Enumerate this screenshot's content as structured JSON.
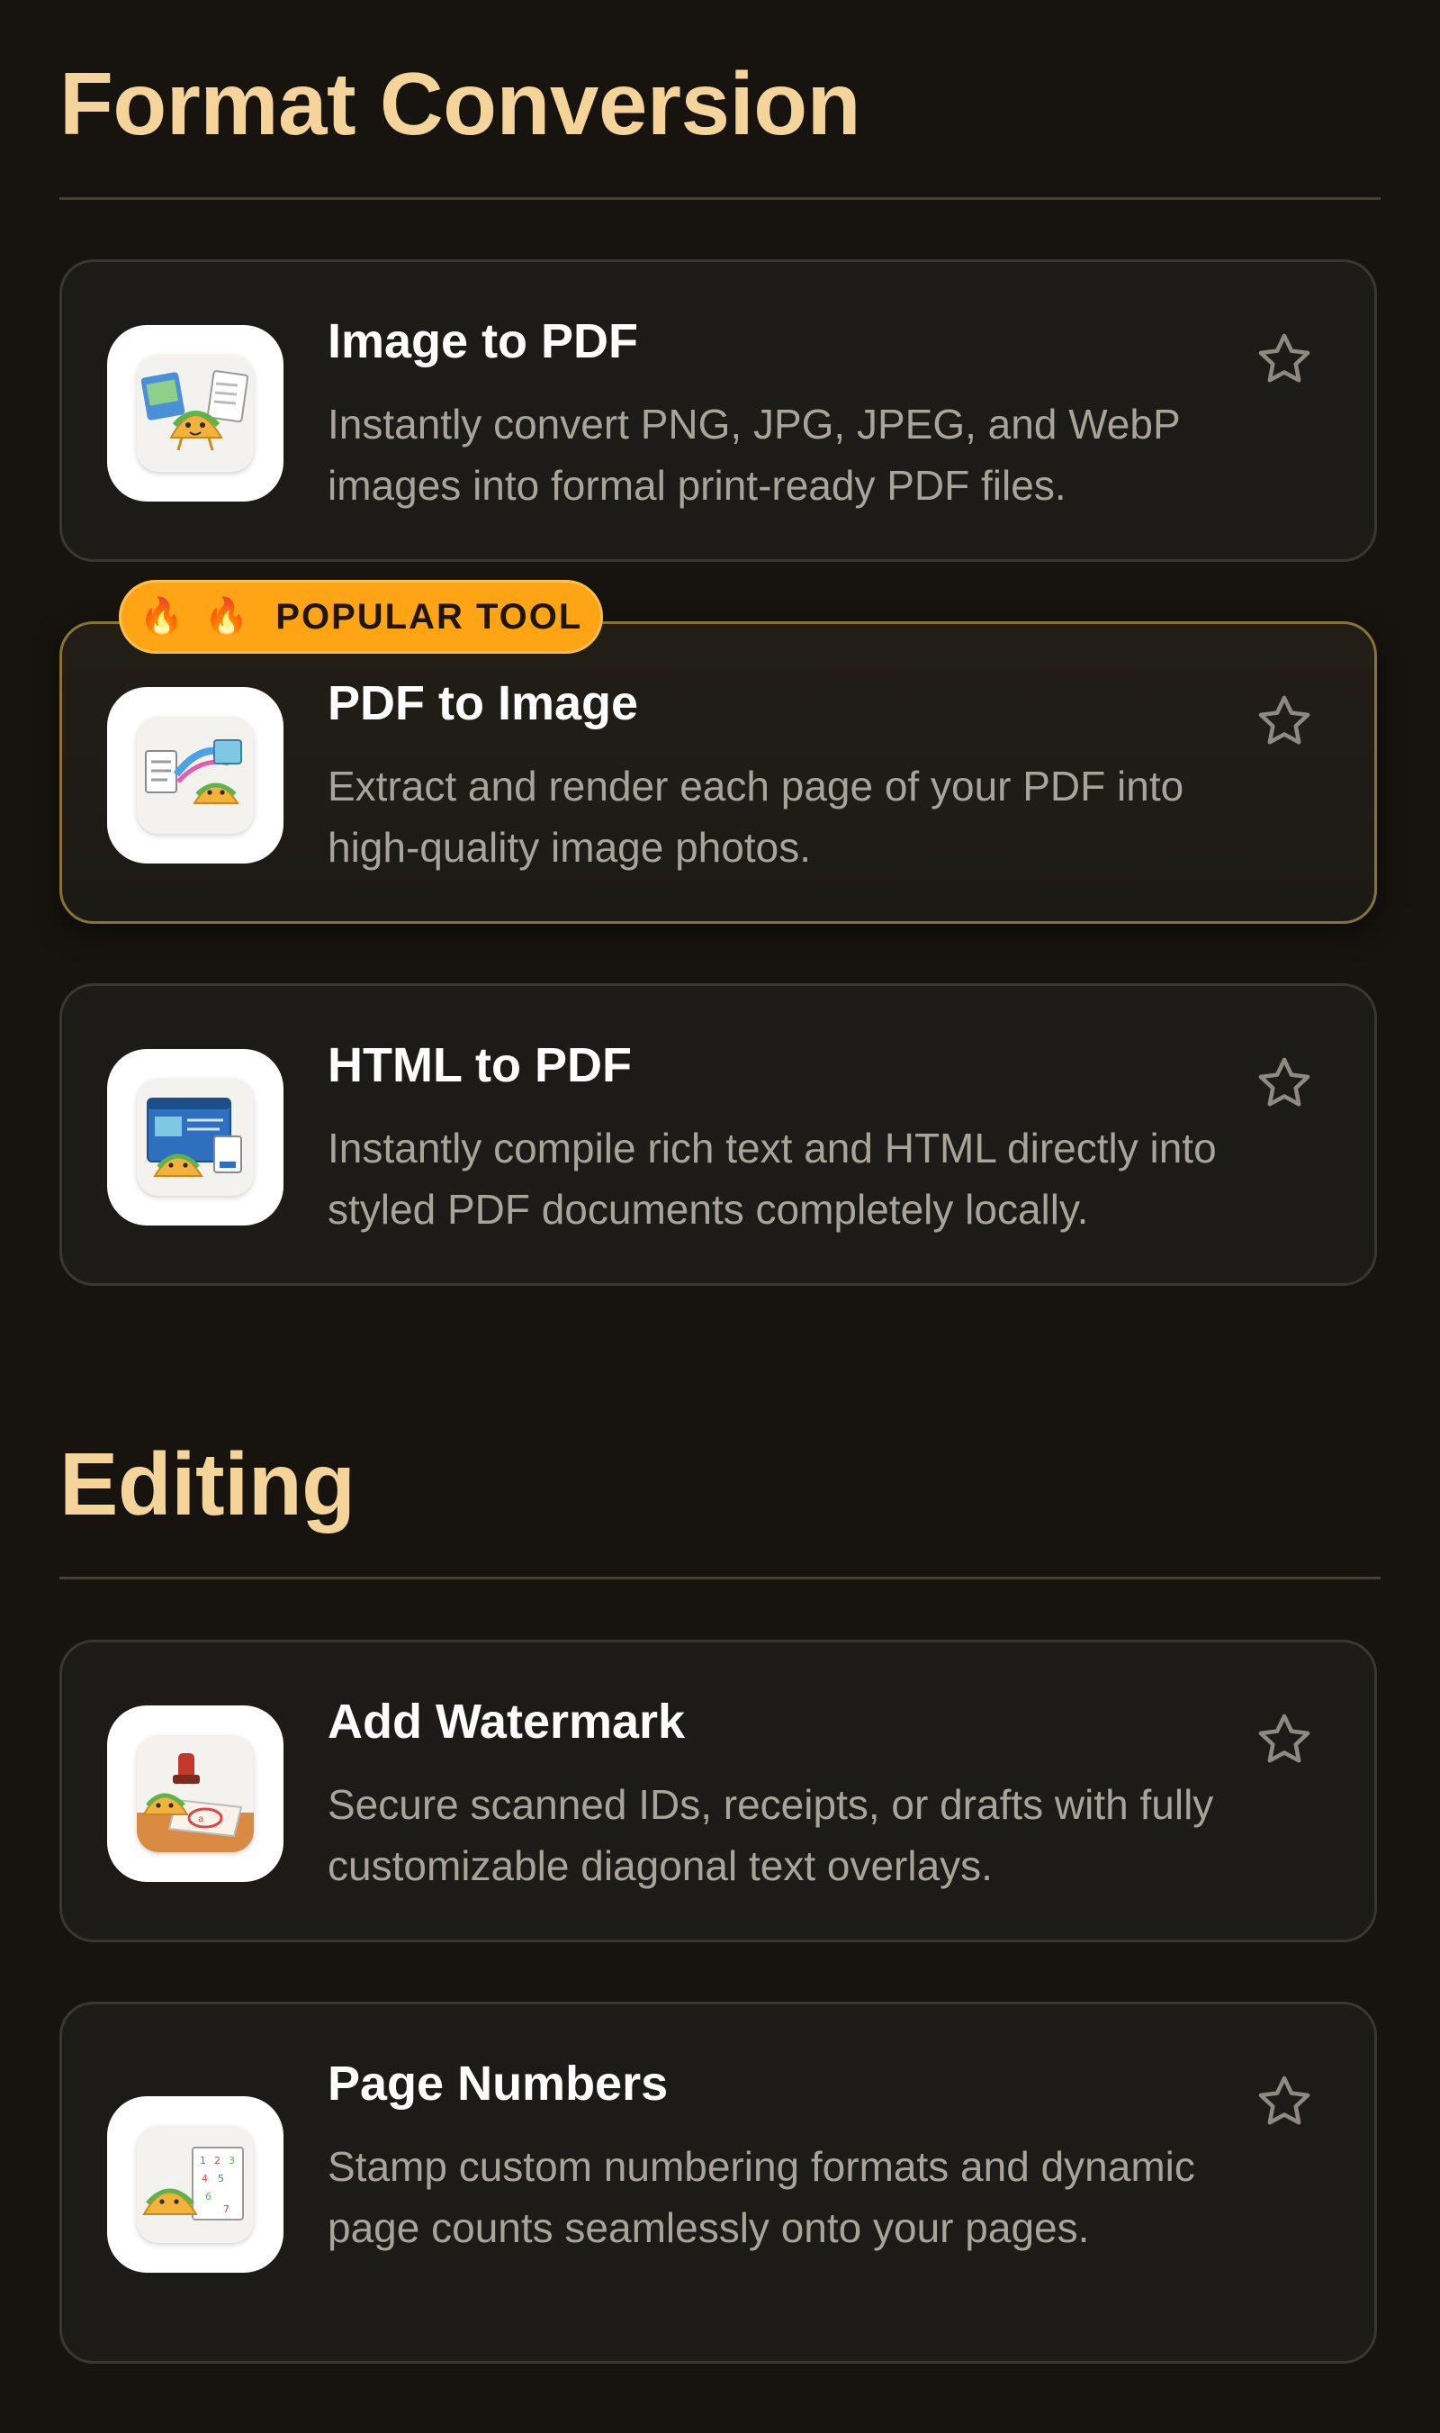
{
  "sections": [
    {
      "title": "Format Conversion",
      "cards": [
        {
          "title": "Image to PDF",
          "desc": "Instantly convert PNG, JPG, JPEG, and WebP images into formal print-ready PDF files.",
          "icon": "image-to-pdf-taco-icon",
          "starred": false
        },
        {
          "title": "PDF to Image",
          "desc": "Extract and render each page of your PDF into high-quality image photos.",
          "icon": "pdf-to-image-taco-icon",
          "starred": false,
          "badge": {
            "label": "POPULAR TOOL",
            "icon": "fire-icon"
          }
        },
        {
          "title": "HTML to PDF",
          "desc": "Instantly compile rich text and HTML directly into styled PDF documents completely locally.",
          "icon": "html-to-pdf-taco-icon",
          "starred": false
        }
      ]
    },
    {
      "title": "Editing",
      "cards": [
        {
          "title": "Add Watermark",
          "desc": "Secure scanned IDs, receipts, or drafts with fully customizable diagonal text overlays.",
          "icon": "watermark-taco-icon",
          "starred": false
        },
        {
          "title": "Page Numbers",
          "desc": "Stamp custom numbering formats and dynamic page counts seamlessly onto your pages.",
          "icon": "page-numbers-taco-icon",
          "starred": false
        }
      ]
    }
  ],
  "colors": {
    "background": "#17140f",
    "section_title": "#f5d49a",
    "badge": "#ffa515",
    "star_outline": "#8e8a82"
  }
}
